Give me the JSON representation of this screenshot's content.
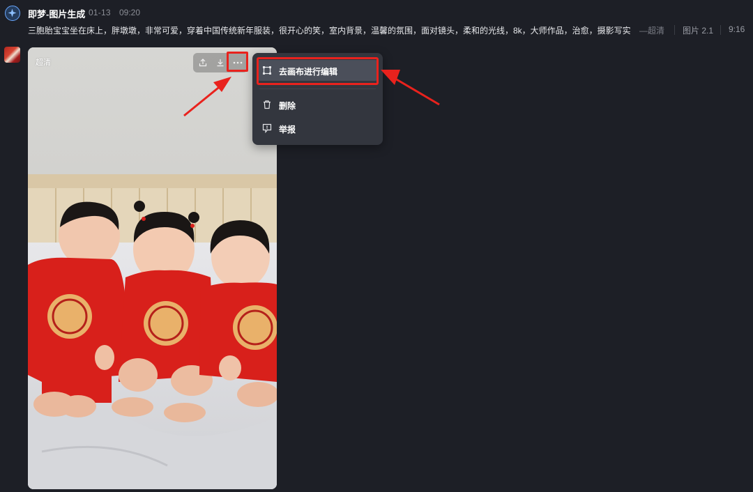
{
  "header": {
    "app_name": "即梦-图片生成",
    "date": "01-13",
    "time": "09:20",
    "prompt": "三胞胎宝宝坐在床上，胖墩墩，非常可爱，穿着中国传统新年服装，很开心的笑，室内背景，温馨的氛围，面对镜头，柔和的光线，8k，大师作品，治愈，摄影写实",
    "quality_tag": "—超清",
    "model_tag": "图片 2.1",
    "ratio_tag": "9:16"
  },
  "image_card": {
    "badge": "超清",
    "toolbar": {
      "share_icon": "share-icon",
      "download_icon": "download-icon",
      "more_icon": "more-icon"
    }
  },
  "context_menu": {
    "items": [
      {
        "label": "去画布进行编辑",
        "icon": "canvas-edit-icon",
        "active": true
      },
      {
        "label": "删除",
        "icon": "trash-icon",
        "active": false
      },
      {
        "label": "举报",
        "icon": "report-icon",
        "active": false
      }
    ]
  },
  "colors": {
    "background": "#1d1f26",
    "menu_bg": "#33363e",
    "menu_active": "#4b4f5a",
    "annotation_red": "#e9221d",
    "accent_blue": "#6aa8ff"
  }
}
